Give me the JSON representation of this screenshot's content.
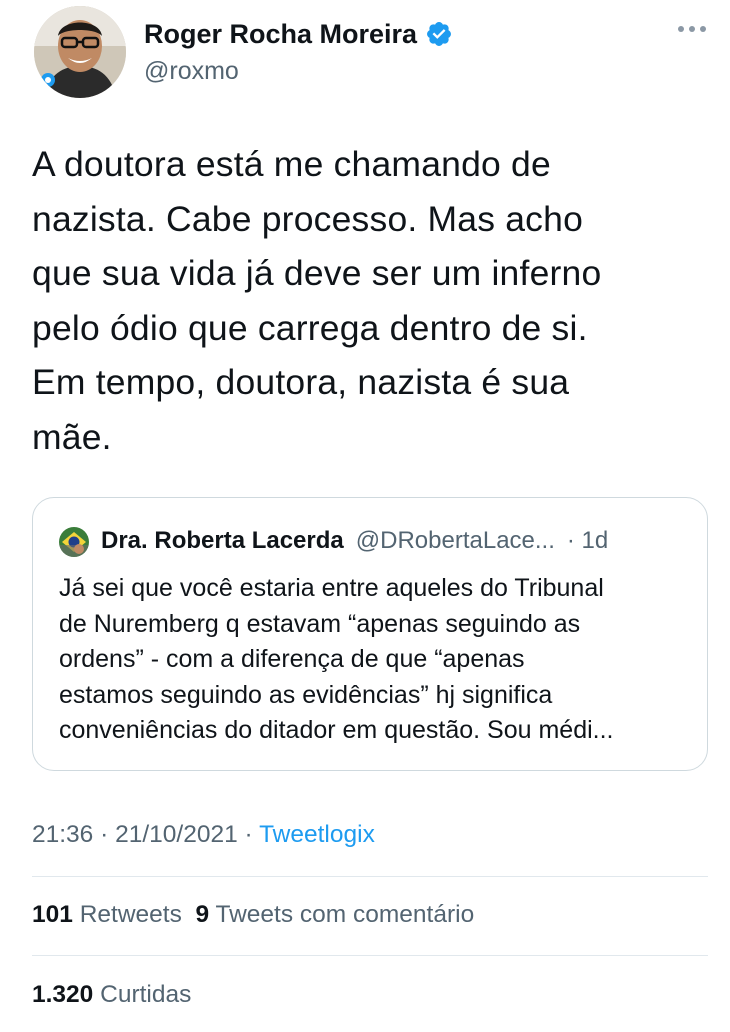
{
  "author": {
    "name": "Roger Rocha Moreira",
    "handle": "@roxmo",
    "verified": true
  },
  "tweet": {
    "lines": [
      "A doutora está me chamando de",
      "nazista. Cabe processo. Mas acho",
      "que sua vida já deve ser um inferno",
      "pelo ódio que carrega dentro de si.",
      "Em tempo, doutora, nazista é sua",
      "mãe."
    ]
  },
  "quote": {
    "name": "Dra. Roberta Lacerda",
    "handle": "@DRobertaLace...",
    "time": "· 1d",
    "lines": [
      "Já sei que você estaria entre aqueles do Tribunal",
      "de Nuremberg q estavam “apenas seguindo as",
      "ordens” - com a diferença de que “apenas",
      "estamos seguindo as evidências” hj significa",
      "conveniências do ditador em questão. Sou médi..."
    ]
  },
  "meta": {
    "time": "21:36",
    "date": "21/10/2021",
    "separator": " · ",
    "source": "Tweetlogix"
  },
  "stats": {
    "retweets_count": "101",
    "retweets_label": "Retweets",
    "quotes_count": "9",
    "quotes_label": "Tweets com comentário",
    "likes_count": "1.320",
    "likes_label": "Curtidas"
  },
  "colors": {
    "accent": "#1d9bf0",
    "text": "#0f1419",
    "secondary": "#536471",
    "border": "#cfd9de"
  },
  "icons": [
    "avatar",
    "verified-badge-icon",
    "more-options-icon",
    "quote-avatar"
  ]
}
